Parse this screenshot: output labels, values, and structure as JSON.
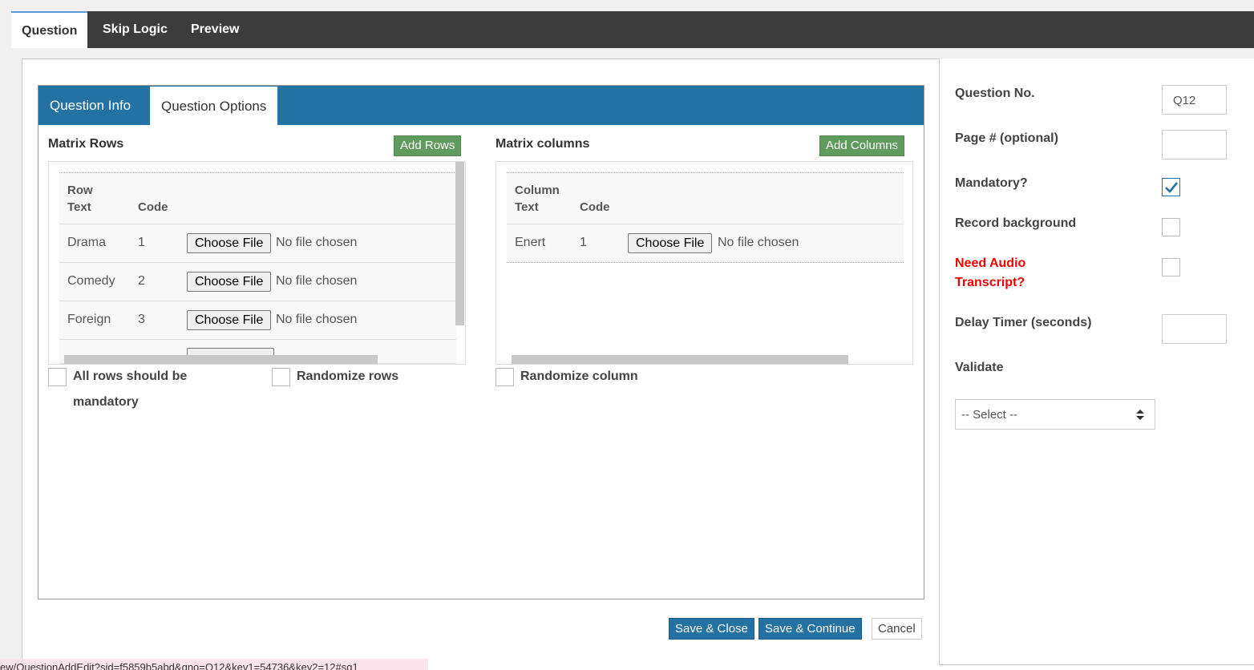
{
  "top_tabs": [
    {
      "label": "Question"
    },
    {
      "label": "Skip Logic"
    },
    {
      "label": "Preview"
    }
  ],
  "inner_tabs": [
    {
      "label": "Question Info"
    },
    {
      "label": "Question Options"
    }
  ],
  "rows_section": {
    "title": "Matrix Rows",
    "add_button": "Add Rows",
    "header_text_line1": "Row",
    "header_text_line2": "Text",
    "header_code": "Code",
    "rows": [
      {
        "text": "Drama",
        "code": "1",
        "file_button": "Choose File",
        "file_status": "No file chosen"
      },
      {
        "text": "Comedy",
        "code": "2",
        "file_button": "Choose File",
        "file_status": "No file chosen"
      },
      {
        "text": "Foreign",
        "code": "3",
        "file_button": "Choose File",
        "file_status": "No file chosen"
      }
    ],
    "all_mandatory_label_line1": "All rows should be",
    "all_mandatory_label_line2": "mandatory",
    "randomize_label": "Randomize rows"
  },
  "columns_section": {
    "title": "Matrix columns",
    "add_button": "Add Columns",
    "header_text_line1": "Column",
    "header_text_line2": "Text",
    "header_code": "Code",
    "columns": [
      {
        "text": "Enert",
        "code": "1",
        "file_button": "Choose File",
        "file_status": "No file chosen"
      }
    ],
    "randomize_label": "Randomize column"
  },
  "right_panel": {
    "question_no_label": "Question No.",
    "question_no_value": "Q12",
    "page_label": "Page # (optional)",
    "page_value": "",
    "mandatory_label": "Mandatory?",
    "mandatory_checked": true,
    "record_bg_label": "Record background",
    "audio_label_line1": "Need Audio",
    "audio_label_line2": "Transcript?",
    "delay_label": "Delay Timer (seconds)",
    "delay_value": "",
    "validate_label": "Validate",
    "validate_selected": "-- Select --"
  },
  "actions": {
    "save_close": "Save & Close",
    "save_continue": "Save & Continue",
    "cancel": "Cancel"
  },
  "status_url": "ew/QuestionAddEdit?sid=f5859b5abd&qno=Q12&key1=54736&key2=12#sq1",
  "colors": {
    "accent_blue": "#2471a3",
    "add_green": "#5f9a5f",
    "warning_red": "#e00000",
    "topbar": "#3c3c3c"
  }
}
